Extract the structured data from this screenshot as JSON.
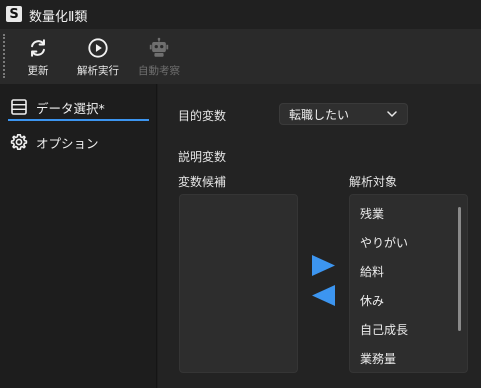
{
  "titlebar": {
    "icon_letter": "S",
    "title": "数量化Ⅱ類"
  },
  "toolbar": {
    "refresh_label": "更新",
    "run_label": "解析実行",
    "auto_label": "自動考察"
  },
  "sidebar": {
    "items": [
      {
        "label": "データ選択*",
        "icon": "table-icon"
      },
      {
        "label": "オプション",
        "icon": "gear-icon"
      }
    ]
  },
  "main": {
    "target_label": "目的変数",
    "target_value": "転職したい",
    "explanatory_label": "説明変数",
    "candidates_label": "変数候補",
    "selected_label": "解析対象",
    "candidates": [],
    "selected": [
      "残業",
      "やりがい",
      "給料",
      "休み",
      "自己成長",
      "業務量"
    ]
  },
  "colors": {
    "accent": "#3c95f0",
    "background": "#232323",
    "sidebar": "#1d1d1d",
    "toolbar": "#2a2a2a"
  }
}
